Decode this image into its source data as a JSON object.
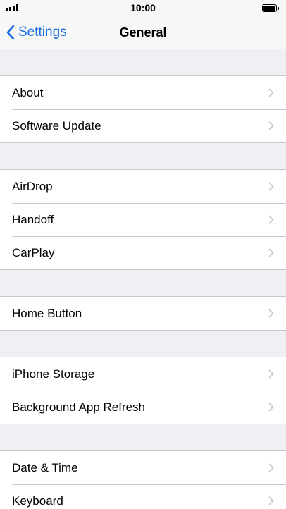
{
  "status_bar": {
    "time": "10:00"
  },
  "nav": {
    "back_label": "Settings",
    "title": "General"
  },
  "groups": [
    {
      "items": [
        {
          "label": "About"
        },
        {
          "label": "Software Update"
        }
      ]
    },
    {
      "items": [
        {
          "label": "AirDrop"
        },
        {
          "label": "Handoff"
        },
        {
          "label": "CarPlay"
        }
      ]
    },
    {
      "items": [
        {
          "label": "Home Button"
        }
      ]
    },
    {
      "items": [
        {
          "label": "iPhone Storage"
        },
        {
          "label": "Background App Refresh"
        }
      ]
    },
    {
      "items": [
        {
          "label": "Date & Time"
        },
        {
          "label": "Keyboard"
        }
      ]
    }
  ],
  "colors": {
    "accent": "#1a6fe0",
    "chevron": "#c7c7cc",
    "separator": "#c8c7cc",
    "background": "#efeff4"
  },
  "icons": {
    "back": "chevron-left-icon",
    "row_disclosure": "chevron-right-icon"
  }
}
